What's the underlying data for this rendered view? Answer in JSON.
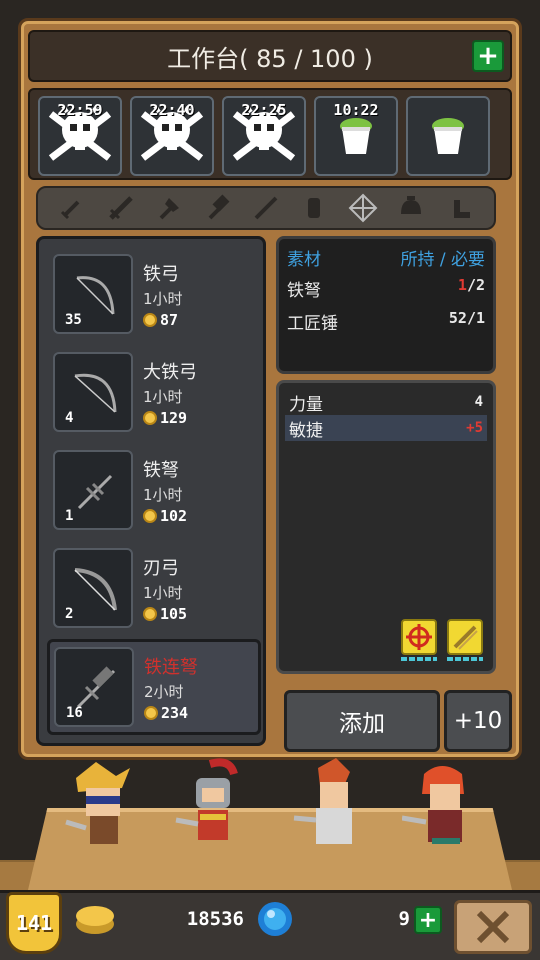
{
  "header": {
    "title": "工作台( 85 / 100 )",
    "add_icon": "plus-icon"
  },
  "queue": [
    {
      "time": "22:59",
      "icon": "skull-crossbones-icon"
    },
    {
      "time": "22:40",
      "icon": "skull-crossbones-icon"
    },
    {
      "time": "22:25",
      "icon": "skull-crossbones-icon"
    },
    {
      "time": "10:22",
      "icon": "green-pot-icon"
    },
    {
      "time": "",
      "icon": "green-pot-icon"
    }
  ],
  "filters": [
    "dagger-icon",
    "sword-icon",
    "axe-icon",
    "hammer-icon",
    "spear-icon",
    "shield-icon",
    "bow-icon",
    "helmet-icon",
    "boot-icon"
  ],
  "recipes": [
    {
      "name": "铁弓",
      "time": "1小时",
      "cost": "87",
      "count": "35"
    },
    {
      "name": "大铁弓",
      "time": "1小时",
      "cost": "129",
      "count": "4"
    },
    {
      "name": "铁弩",
      "time": "1小时",
      "cost": "102",
      "count": "1"
    },
    {
      "name": "刃弓",
      "time": "1小时",
      "cost": "105",
      "count": "2"
    },
    {
      "name": "铁连弩",
      "time": "2小时",
      "cost": "234",
      "count": "16"
    }
  ],
  "materials": {
    "header_left": "素材",
    "header_right": "所持 / 必要",
    "rows": [
      {
        "name": "铁弩",
        "have": "1",
        "need": "/2"
      },
      {
        "name": "工匠锤",
        "have": "52",
        "need": "/1"
      }
    ]
  },
  "stats": [
    {
      "name": "力量",
      "value": "4"
    },
    {
      "name": "敏捷",
      "value": "+5"
    }
  ],
  "actions": {
    "add": "添加",
    "plus10": "+10"
  },
  "footer": {
    "level": "141",
    "gold": "18536",
    "gems": "9"
  },
  "colors": {
    "accent_green": "#1a9a3a",
    "wood": "#a9763e",
    "warning_red": "#e03b33",
    "link_blue": "#3fa1e0"
  }
}
